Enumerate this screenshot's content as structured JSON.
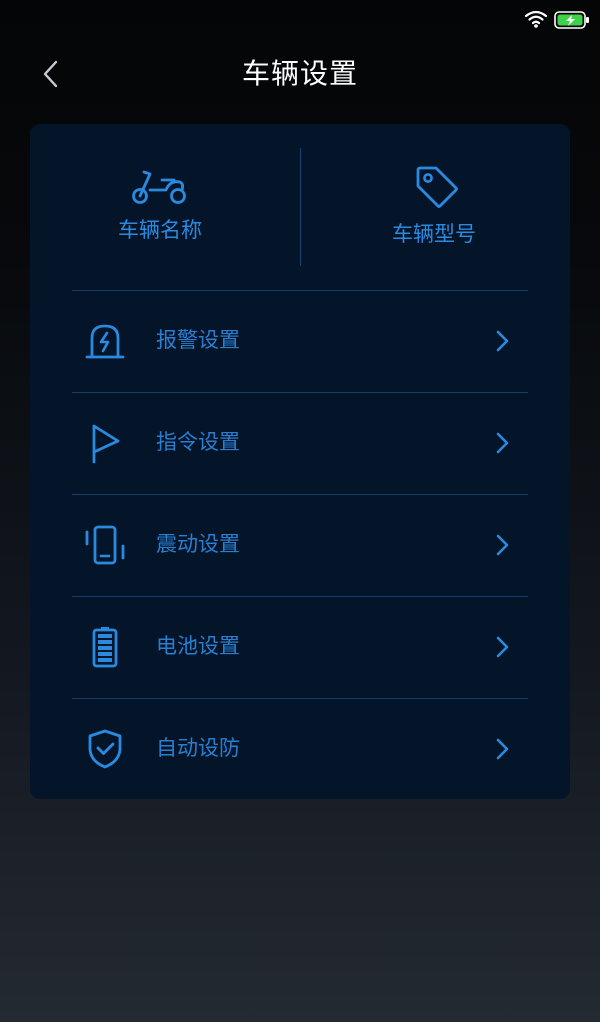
{
  "status_bar": {
    "wifi_icon": "wifi-icon",
    "battery_icon": "battery-charging-icon"
  },
  "header": {
    "title": "车辆设置",
    "back_icon": "chevron-left-icon"
  },
  "vehicle_info": [
    {
      "label": "车辆名称",
      "icon": "scooter-icon"
    },
    {
      "label": "车辆型号",
      "icon": "tag-icon"
    }
  ],
  "settings": [
    {
      "label": "报警设置",
      "icon": "alarm-light-icon"
    },
    {
      "label": "指令设置",
      "icon": "flag-icon"
    },
    {
      "label": "震动设置",
      "icon": "vibrate-phone-icon"
    },
    {
      "label": "电池设置",
      "icon": "battery-icon"
    },
    {
      "label": "自动设防",
      "icon": "shield-check-icon"
    }
  ],
  "colors": {
    "accent": "#2a8ae0",
    "card": "#04152a",
    "divider": "#163e66",
    "title": "#ffffff"
  }
}
